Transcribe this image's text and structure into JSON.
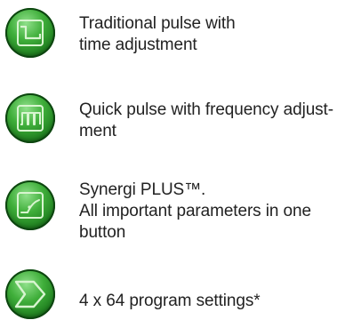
{
  "items": [
    {
      "icon": "traditional-pulse-icon",
      "lines": [
        "Traditional pulse with",
        "time adjustment"
      ]
    },
    {
      "icon": "quick-pulse-icon",
      "lines": [
        "Quick pulse with frequency adjust-",
        "ment"
      ]
    },
    {
      "icon": "synergi-plus-icon",
      "lines": [
        "Synergi PLUS™.",
        "All important parameters in one",
        "button"
      ]
    },
    {
      "icon": "program-settings-icon",
      "lines": [
        "4 x 64 program settings*"
      ]
    }
  ],
  "colors": {
    "button_green": "#3fae3a",
    "button_dark": "#0f4f12",
    "glyph": "#d8f5d0"
  }
}
